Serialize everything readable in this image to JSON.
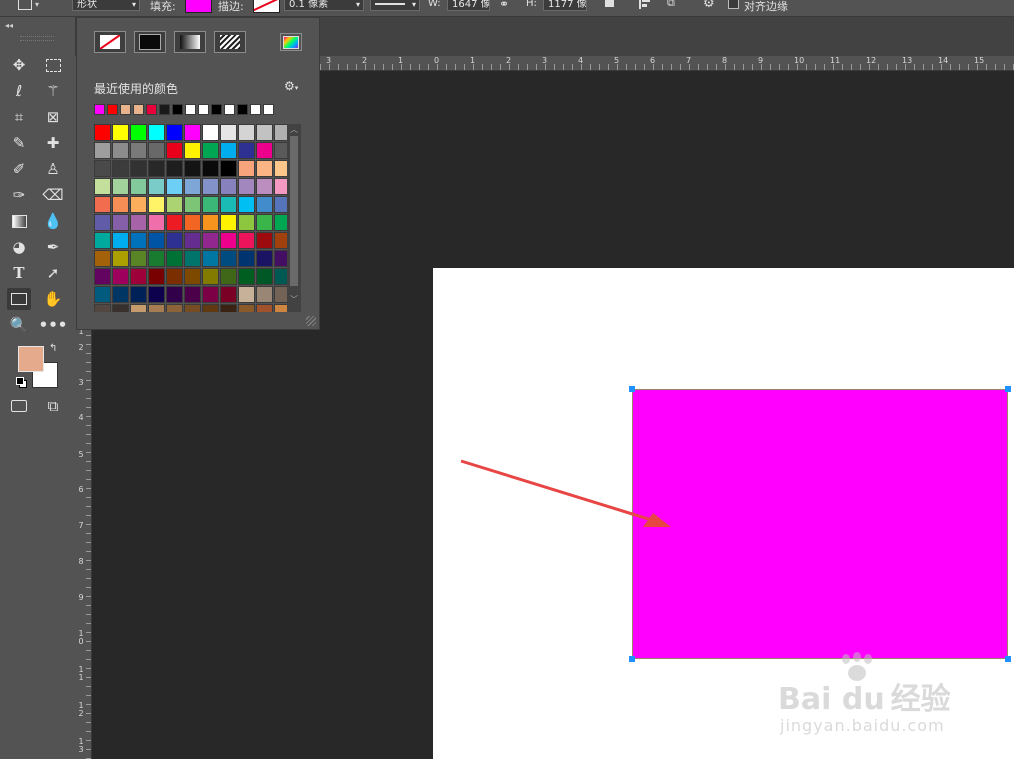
{
  "options_bar": {
    "mode_value": "形状",
    "fill_label": "填充:",
    "fill_color": "#ff00ff",
    "stroke_label": "描边:",
    "stroke_width_value": "0.1 像素",
    "w_label": "W:",
    "w_value": "1647 像",
    "h_label": "H:",
    "h_value": "1177 像",
    "align_edges_label": "对齐边缘"
  },
  "colors": {
    "foreground": "#e4aa8b",
    "background": "#ffffff",
    "shape_fill": "#ff00ff",
    "arrow": "#e84545"
  },
  "swatch_panel": {
    "recent_title": "最近使用的颜色",
    "fill_type_buttons": [
      "no-color",
      "solid-color",
      "gradient",
      "pattern"
    ],
    "recent_colors": [
      "#ff00ff",
      "#ff0000",
      "#e8b28c",
      "#e8b28c",
      "#e8003c",
      "#1a1a1a",
      "#000000",
      "#ffffff",
      "#ffffff",
      "#000000",
      "#ffffff",
      "#000000",
      "#ffffff",
      "#ffffff"
    ],
    "swatch_rows": [
      [
        "#ff0000",
        "#ffff00",
        "#00ff00",
        "#00ffff",
        "#0000ff",
        "#ff00ff",
        "#ffffff",
        "#e6e6e6",
        "#d4d4d4",
        "#c2c2c2",
        "#b0b0b0"
      ],
      [
        "#9e9e9e",
        "#8c8c8c",
        "#7a7a7a",
        "#686868",
        "#e8001a",
        "#fff200",
        "#00a651",
        "#00aeef",
        "#2e3192",
        "#ec008c",
        "#5a5a5a"
      ],
      [
        "#4a4a4a",
        "#3c3c3c",
        "#323232",
        "#282828",
        "#1e1e1e",
        "#141414",
        "#0a0a0a",
        "#000000",
        "#f7a47c",
        "#fbb584",
        "#fdc68a"
      ],
      [
        "#c4df9b",
        "#a3d39c",
        "#82ca9c",
        "#7accc8",
        "#6dcff6",
        "#7ea7d8",
        "#8393ca",
        "#8781bd",
        "#a187be",
        "#bc8dbf",
        "#f49ac2"
      ],
      [
        "#f26c4f",
        "#f68e55",
        "#fbaf5c",
        "#fff467",
        "#acd372",
        "#7cc576",
        "#3bb878",
        "#1abbb4",
        "#00bff3",
        "#438ccb",
        "#5574b9"
      ],
      [
        "#605ca8",
        "#855fa8",
        "#a763a8",
        "#f06eaa",
        "#ed1c24",
        "#f26522",
        "#f7941d",
        "#fff200",
        "#8dc63f",
        "#39b54a",
        "#00a651"
      ],
      [
        "#00a99d",
        "#00aeef",
        "#0072bc",
        "#0054a6",
        "#2e3192",
        "#662d91",
        "#92278f",
        "#ec008c",
        "#ed145b",
        "#9e0b0f",
        "#a0410d"
      ],
      [
        "#a36209",
        "#aba000",
        "#598527",
        "#197b30",
        "#007236",
        "#00746b",
        "#0076a3",
        "#004b80",
        "#003471",
        "#1b1464",
        "#440e62"
      ],
      [
        "#630460",
        "#9e005d",
        "#9e0039",
        "#790000",
        "#7b2e00",
        "#7d4900",
        "#827b00",
        "#406618",
        "#005e20",
        "#005826",
        "#005952"
      ],
      [
        "#005b7f",
        "#003663",
        "#002157",
        "#0d004c",
        "#32004b",
        "#4b0049",
        "#7b0046",
        "#7a0026",
        "#c7b299",
        "#998675",
        "#736357"
      ],
      [
        "#534741",
        "#37302d",
        "#c69c6d",
        "#a67c52",
        "#8c6239",
        "#754c24",
        "#603913",
        "#3b2314",
        "#8b5a2b",
        "#a0522d",
        "#cd853f"
      ]
    ]
  },
  "hruler_labels": [
    "3",
    "2",
    "1",
    "0",
    "1",
    "2",
    "3",
    "4",
    "5",
    "6",
    "7",
    "8",
    "9",
    "10",
    "11",
    "12",
    "13",
    "14",
    "15"
  ],
  "vruler_labels": [
    "1",
    "2",
    "3",
    "4",
    "5",
    "6",
    "7",
    "8",
    "9",
    "10",
    "11",
    "12",
    "13"
  ],
  "watermark": {
    "brand": "Bai du",
    "product": "经验",
    "url": "jingyan.baidu.com"
  }
}
